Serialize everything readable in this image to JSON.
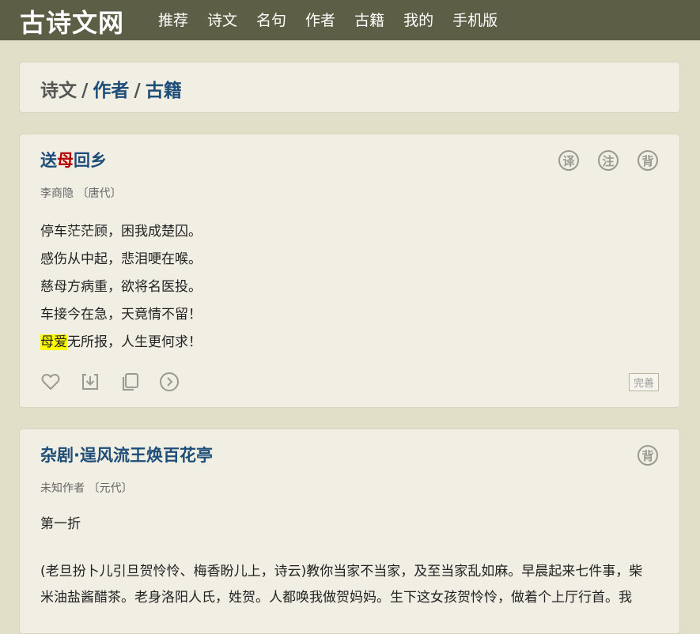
{
  "site": {
    "logo": "古诗文网",
    "nav": [
      "推荐",
      "诗文",
      "名句",
      "作者",
      "古籍",
      "我的",
      "手机版"
    ]
  },
  "breadcrumb": {
    "current": "诗文",
    "sep": "/",
    "links": [
      "作者",
      "古籍"
    ]
  },
  "poems": [
    {
      "title_highlight": "母",
      "title_pre": "送",
      "title_post": "回乡",
      "author": "李商隐 〔唐代〕",
      "actions": [
        "译",
        "注",
        "背"
      ],
      "lines": [
        "停车茫茫顾，困我成楚囚。",
        "感伤从中起，悲泪哽在喉。",
        "慈母方病重，欲将名医投。",
        "车接今在急，天竟情不留！"
      ],
      "last_line_mark": "母爱",
      "last_line_rest": "无所报，人生更何求！",
      "tools": [
        "heart-icon",
        "download-icon",
        "copy-icon",
        "next-icon"
      ],
      "improve_label": "完善"
    },
    {
      "title": "杂剧·逞风流王焕百花亭",
      "author": "未知作者 〔元代〕",
      "actions": [
        "背"
      ],
      "para1": "第一折",
      "para2a": "(老旦扮卜儿引旦贺怜怜、梅香盼儿上，诗云)教你当家不当家，及至当家乱如麻。早晨起来七件事，柴",
      "para2b": "米油盐酱醋茶。老身洛阳人氏，姓贺。人都唤我做贺妈妈。生下这女孩贺怜怜，做着个上厅行首。我"
    }
  ]
}
